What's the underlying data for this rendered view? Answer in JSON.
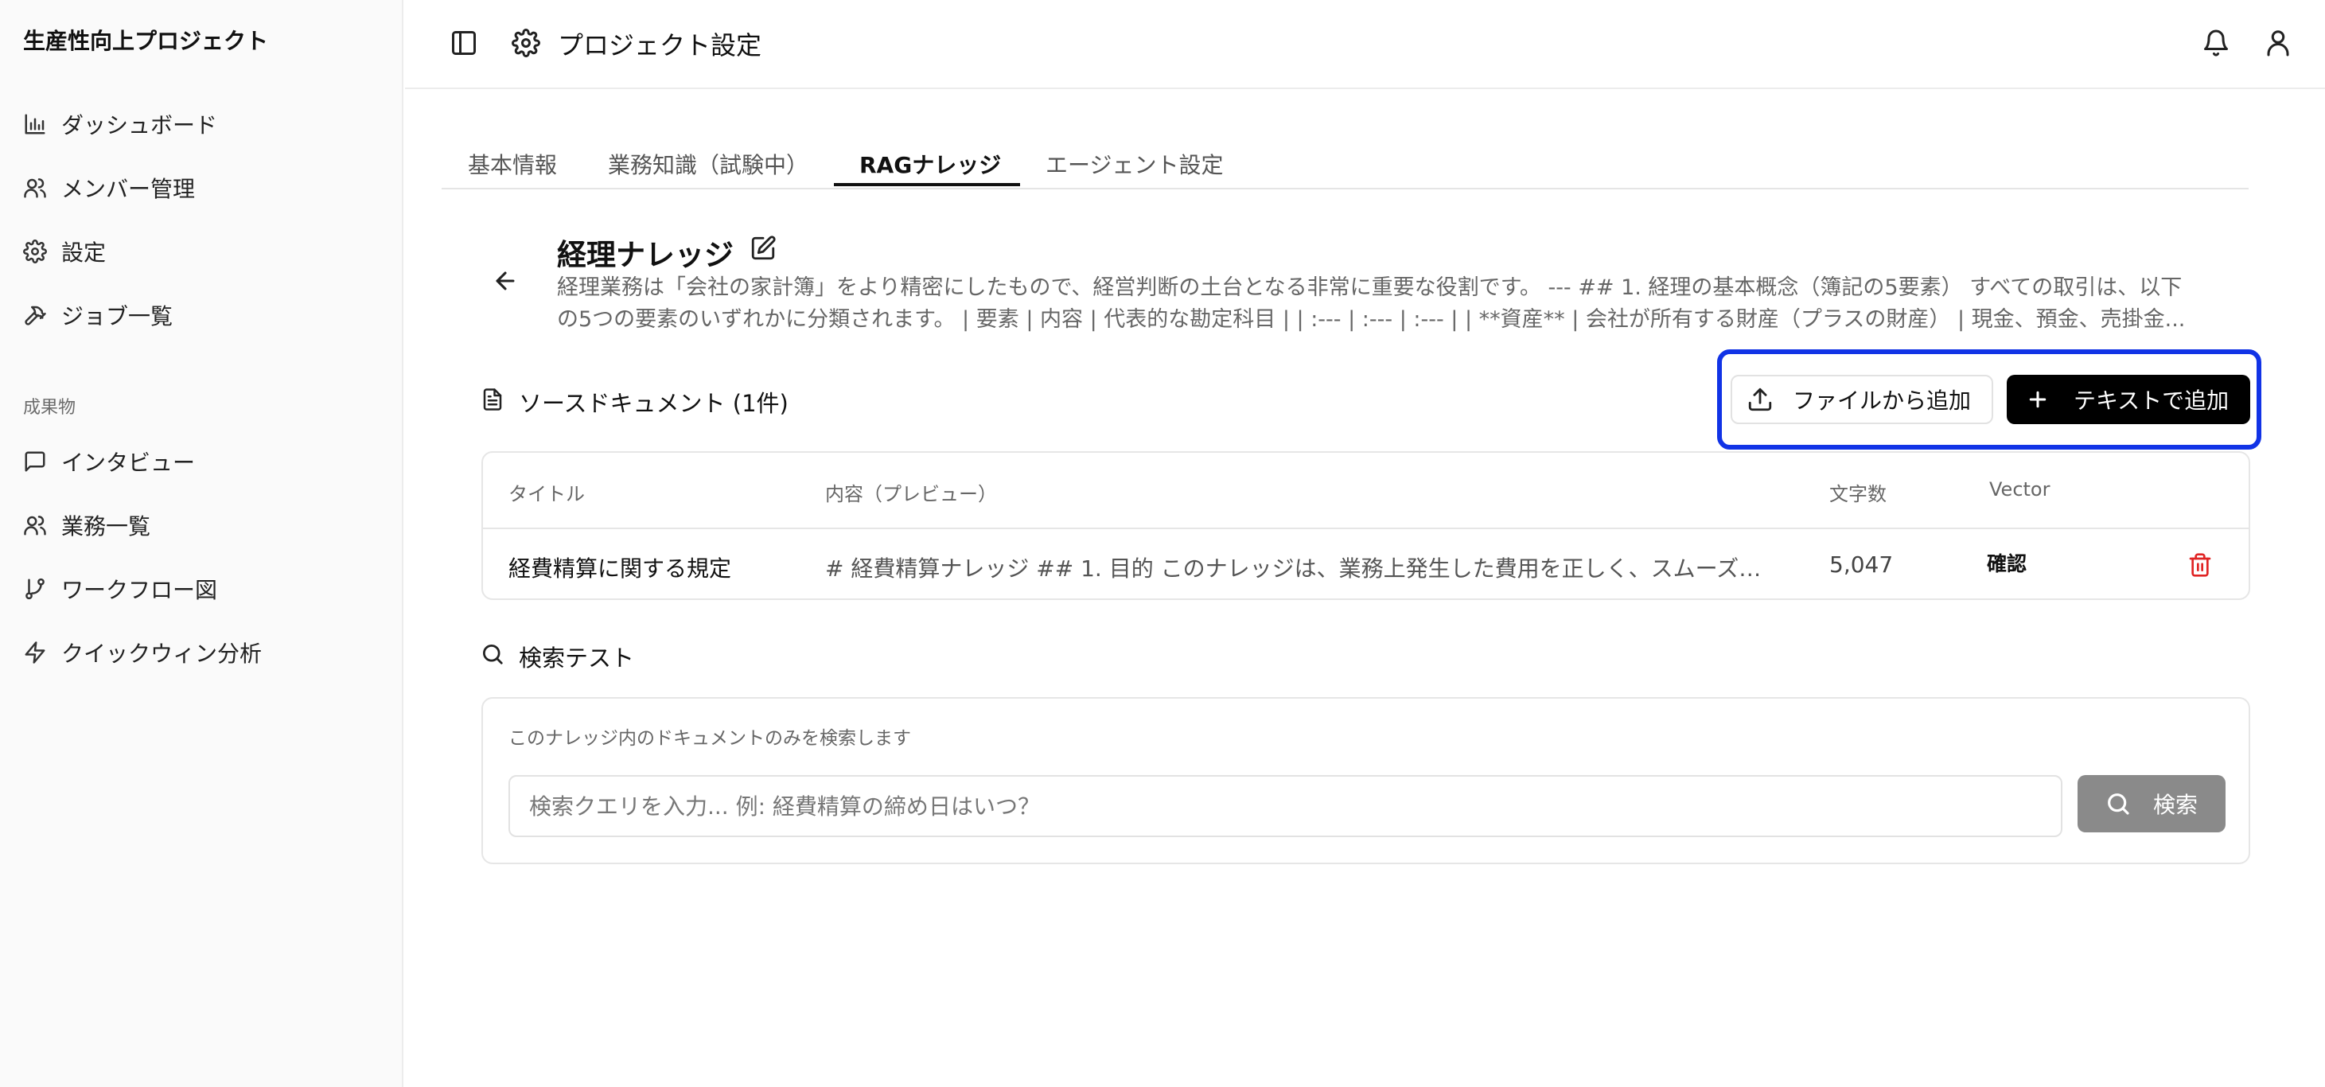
{
  "sidebar": {
    "app_title": "生産性向上プロジェクト",
    "items": [
      {
        "label": "ダッシュボード",
        "icon": "bar-chart-icon"
      },
      {
        "label": "メンバー管理",
        "icon": "users-icon"
      },
      {
        "label": "設定",
        "icon": "gear-icon"
      },
      {
        "label": "ジョブ一覧",
        "icon": "hammer-icon"
      }
    ],
    "section_label": "成果物",
    "section_items": [
      {
        "label": "インタビュー",
        "icon": "message-square-icon"
      },
      {
        "label": "業務一覧",
        "icon": "users-icon"
      },
      {
        "label": "ワークフロー図",
        "icon": "git-branch-icon"
      },
      {
        "label": "クイックウィン分析",
        "icon": "zap-icon"
      }
    ]
  },
  "header": {
    "title": "プロジェクト設定"
  },
  "tabs": [
    {
      "label": "基本情報",
      "active": false
    },
    {
      "label": "業務知識（試験中）",
      "active": false
    },
    {
      "label": "RAGナレッジ",
      "active": true
    },
    {
      "label": "エージェント設定",
      "active": false
    }
  ],
  "knowledge": {
    "title": "経理ナレッジ",
    "description_line1": "経理業務は「会社の家計簿」をより精密にしたもので、経営判断の土台となる非常に重要な役割です。 --- ## 1. 経理の基本概念（簿記の5要素） すべての取引は、以下",
    "description_line2": "の5つの要素のいずれかに分類されます。 | 要素 | 内容 | 代表的な勘定科目 | | :--- | :--- | :--- | | **資産** | 会社が所有する財産（プラスの財産） | 現金、預金、売掛金..."
  },
  "documents": {
    "section_title": "ソースドキュメント (1件)",
    "add_file_label": "ファイルから追加",
    "add_text_label": "テキストで追加",
    "highlight_color": "#1133e6",
    "columns": {
      "title": "タイトル",
      "preview": "内容（プレビュー）",
      "chars": "文字数",
      "vector": "Vector"
    },
    "rows": [
      {
        "title": "経費精算に関する規定",
        "preview": "# 経費精算ナレッジ ## 1. 目的 このナレッジは、業務上発生した費用を正しく、スムーズに...",
        "chars": "5,047",
        "vector_action": "確認"
      }
    ]
  },
  "search": {
    "section_title": "検索テスト",
    "hint": "このナレッジ内のドキュメントのみを検索します",
    "placeholder": "検索クエリを入力... 例: 経費精算の締め日はいつ？",
    "value": "",
    "button_label": "検索"
  }
}
